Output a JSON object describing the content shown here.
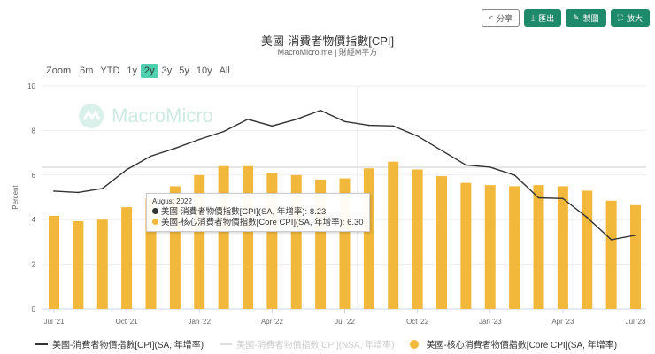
{
  "toolbar": {
    "share": "分享",
    "export": "匯出",
    "draw": "製圖",
    "fullscreen": "放大"
  },
  "header": {
    "title": "美國-消費者物價指數[CPI]",
    "subtitle": "MacroMicro.me | 財經M平方",
    "watermark": "MacroMicro"
  },
  "range_selector": {
    "label": "Zoom",
    "options": [
      "6m",
      "YTD",
      "1y",
      "2y",
      "3y",
      "5y",
      "10y",
      "All"
    ],
    "active": "2y"
  },
  "tooltip": {
    "date": "August 2022",
    "rows": [
      {
        "label": "美國-消費者物價指數[CPI](SA, 年增率): ",
        "value": "8.23"
      },
      {
        "label": "美國-核心消費者物價指數[Core CPI](SA, 年增率): ",
        "value": "6.30"
      }
    ]
  },
  "chart_data": {
    "type": "bar+line",
    "title": "美國-消費者物價指數[CPI]",
    "ylabel": "Percent",
    "ylim": [
      0,
      10
    ],
    "yticks": [
      "0",
      "2",
      "4",
      "6",
      "8",
      "10"
    ],
    "xticks": [
      {
        "i": 0,
        "label": "Jul '21"
      },
      {
        "i": 3,
        "label": "Oct '21"
      },
      {
        "i": 6,
        "label": "Jan '22"
      },
      {
        "i": 9,
        "label": "Apr '22"
      },
      {
        "i": 12,
        "label": "Jul '22"
      },
      {
        "i": 15,
        "label": "Oct '22"
      },
      {
        "i": 18,
        "label": "Jan '23"
      },
      {
        "i": 21,
        "label": "Apr '23"
      },
      {
        "i": 24,
        "label": "Jul '23"
      }
    ],
    "categories": [
      "2021-07",
      "2021-08",
      "2021-09",
      "2021-10",
      "2021-11",
      "2021-12",
      "2022-01",
      "2022-02",
      "2022-03",
      "2022-04",
      "2022-05",
      "2022-06",
      "2022-07",
      "2022-08",
      "2022-09",
      "2022-10",
      "2022-11",
      "2022-12",
      "2023-01",
      "2023-02",
      "2023-03",
      "2023-04",
      "2023-05",
      "2023-06",
      "2023-07"
    ],
    "series": [
      {
        "name": "美國-消費者物價指數[CPI](SA, 年增率)",
        "type": "line",
        "color": "#333333",
        "values": [
          5.28,
          5.22,
          5.4,
          6.24,
          6.85,
          7.2,
          7.6,
          7.95,
          8.5,
          8.2,
          8.5,
          8.9,
          8.4,
          8.23,
          8.2,
          7.75,
          7.1,
          6.45,
          6.35,
          6.0,
          4.98,
          4.95,
          4.1,
          3.1,
          3.3
        ]
      },
      {
        "name": "美國-消費者物價指數[CPI](NSA, 年增率)",
        "type": "line",
        "color": "#cccccc",
        "hidden": true,
        "values": []
      },
      {
        "name": "美國-核心消費者物價指數[Core CPI](SA, 年增率)",
        "type": "bar",
        "color": "#f2b83c",
        "values": [
          4.17,
          3.93,
          4.0,
          4.56,
          4.95,
          5.5,
          6.0,
          6.4,
          6.4,
          6.1,
          6.0,
          5.8,
          5.85,
          6.3,
          6.6,
          6.25,
          5.95,
          5.65,
          5.55,
          5.5,
          5.55,
          5.5,
          5.3,
          4.85,
          4.65
        ]
      }
    ],
    "crosshair_index": 13,
    "legend": "bottom"
  }
}
